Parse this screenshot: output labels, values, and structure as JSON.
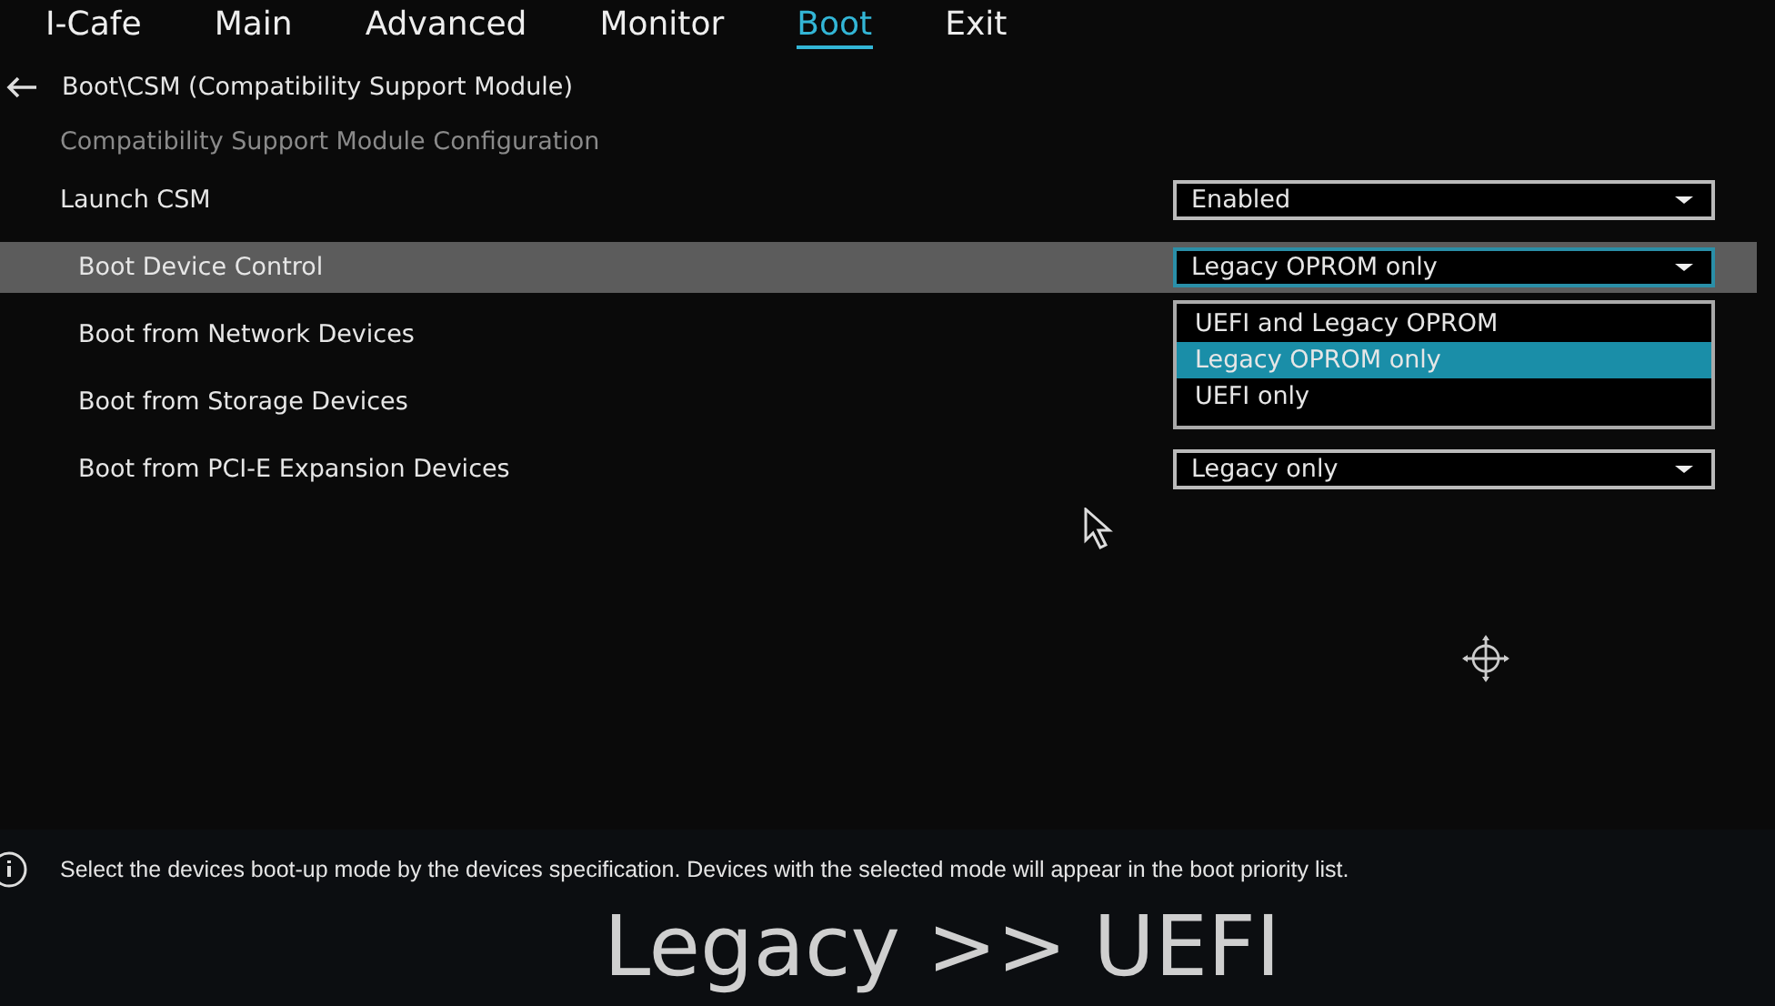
{
  "tabs": [
    {
      "label": "I-Cafe",
      "selected": false
    },
    {
      "label": "Main",
      "selected": false
    },
    {
      "label": "Advanced",
      "selected": false
    },
    {
      "label": "Monitor",
      "selected": false
    },
    {
      "label": "Boot",
      "selected": true
    },
    {
      "label": "Exit",
      "selected": false
    }
  ],
  "breadcrumb": "Boot\\CSM (Compatibility Support Module)",
  "section_title": "Compatibility Support Module Configuration",
  "settings": [
    {
      "label": "Launch CSM",
      "kind": "top",
      "selected": false,
      "value": "Enabled"
    },
    {
      "label": "Boot Device Control",
      "kind": "sub",
      "selected": true,
      "value": "Legacy OPROM only",
      "options": [
        {
          "label": "UEFI and Legacy OPROM",
          "selected": false
        },
        {
          "label": "Legacy OPROM only",
          "selected": true
        },
        {
          "label": "UEFI only",
          "selected": false
        }
      ]
    },
    {
      "label": "Boot from Network Devices",
      "kind": "sub",
      "selected": false
    },
    {
      "label": "Boot from Storage Devices",
      "kind": "sub",
      "selected": false
    },
    {
      "label": "Boot from PCI-E Expansion Devices",
      "kind": "sub",
      "selected": false,
      "value": "Legacy only"
    }
  ],
  "help_text": "Select the devices boot-up mode by the devices specification. Devices with the selected mode will appear in the boot priority list.",
  "caption": "Legacy >> UEFI"
}
